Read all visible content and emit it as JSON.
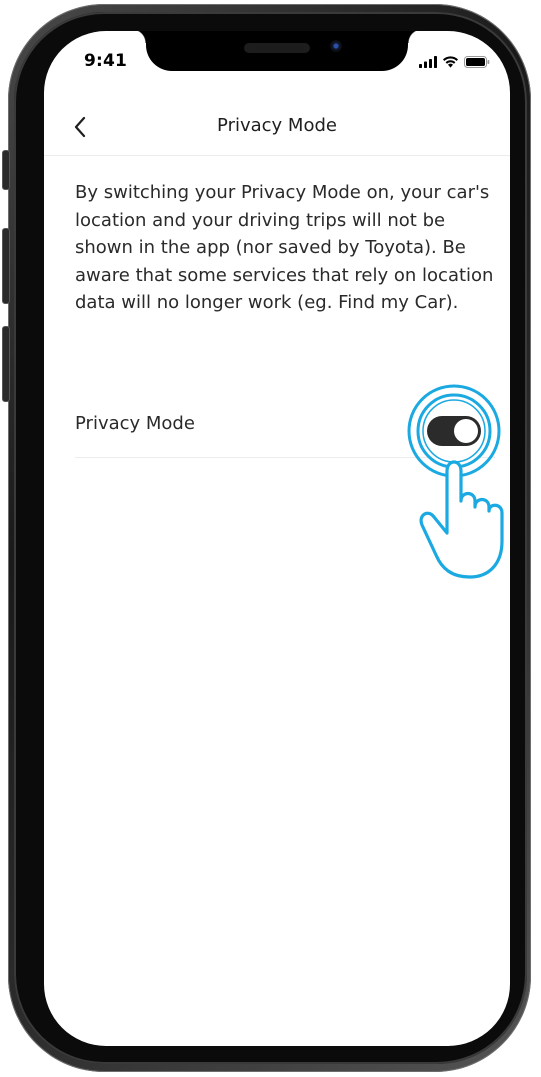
{
  "status_bar": {
    "time": "9:41"
  },
  "nav": {
    "title": "Privacy Mode"
  },
  "content": {
    "description": "By switching your Privacy Mode on, your car's location and your driving trips will not be shown in the app (nor saved by Toyota). Be aware that some services that rely on location data will no longer work (eg. Find my Car).",
    "privacy_mode_label": "Privacy Mode",
    "privacy_mode_enabled": true
  },
  "icons": {
    "back": "chevron-left-icon",
    "signal": "cellular-signal-icon",
    "wifi": "wifi-icon",
    "battery": "battery-icon",
    "tap": "tap-hand-icon"
  },
  "colors": {
    "toggle_on": "#2b2b2b",
    "tap_highlight": "#1ba9e1",
    "text": "#2a2a2a"
  }
}
